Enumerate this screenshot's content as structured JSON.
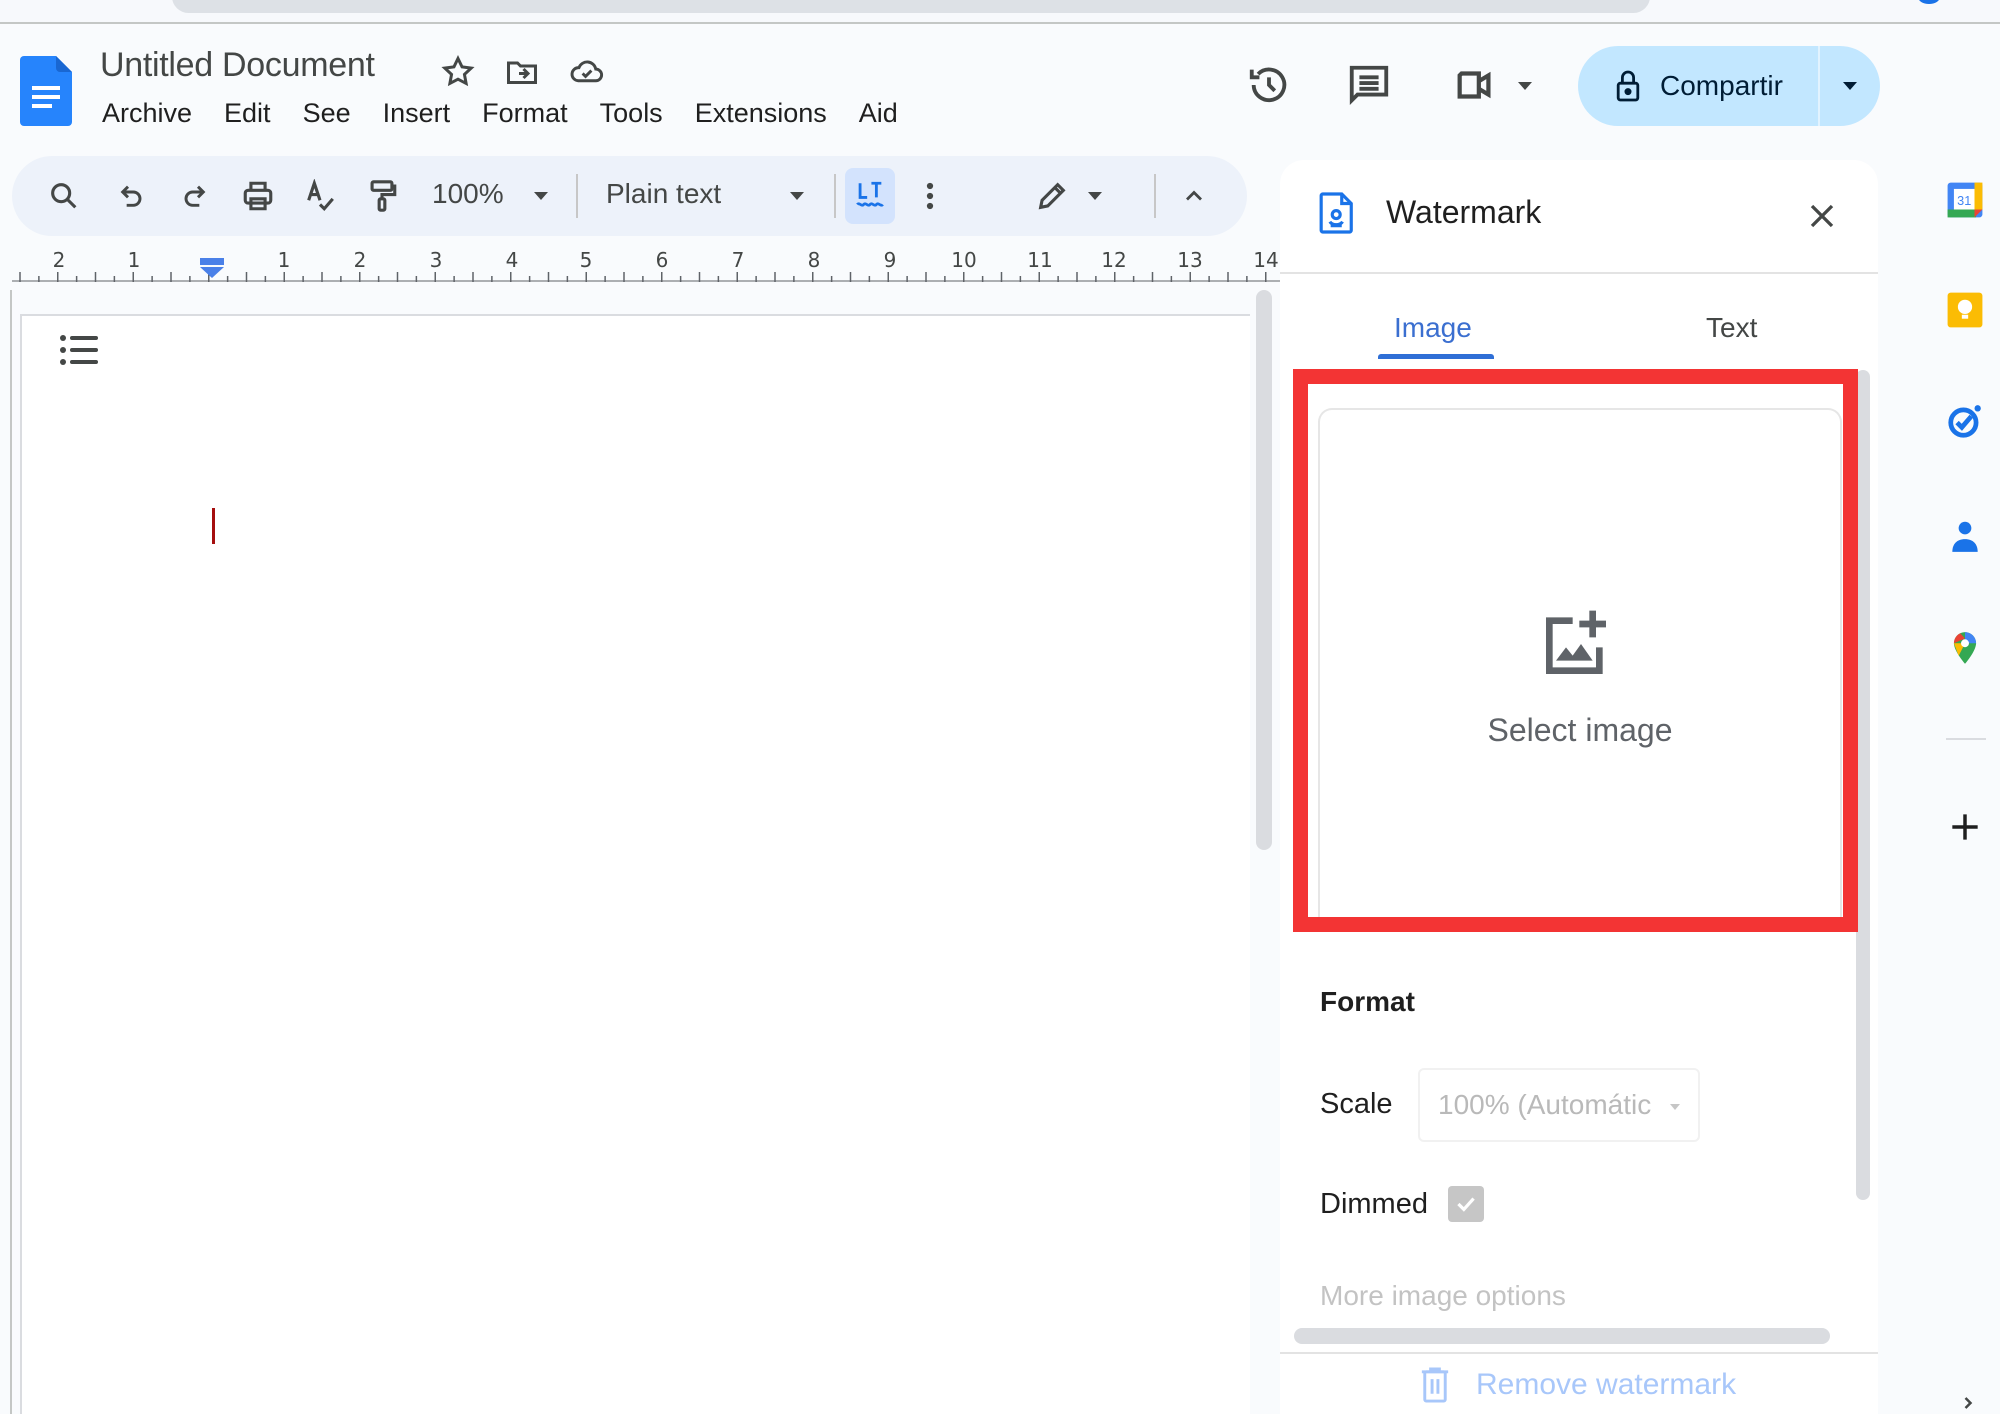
{
  "document": {
    "title": "Untitled Document"
  },
  "menu": [
    "Archive",
    "Edit",
    "See",
    "Insert",
    "Format",
    "Tools",
    "Extensions",
    "Aid"
  ],
  "share": {
    "label": "Compartir"
  },
  "toolbar": {
    "zoom": "100%",
    "style": "Plain text"
  },
  "ruler": {
    "labels": [
      "2",
      "1",
      "1",
      "2",
      "3",
      "4",
      "5",
      "6",
      "7",
      "8",
      "9",
      "10",
      "11",
      "12",
      "13",
      "14"
    ]
  },
  "watermark_panel": {
    "title": "Watermark",
    "tabs": [
      {
        "label": "Image",
        "active": true
      },
      {
        "label": "Text",
        "active": false
      }
    ],
    "select_image_label": "Select image",
    "format_heading": "Format",
    "scale_label": "Scale",
    "scale_value": "100% (Automátic",
    "dimmed_label": "Dimmed",
    "dimmed_checked": true,
    "more_options": "More image options",
    "remove_label": "Remove watermark"
  },
  "right_rail": {
    "apps": [
      "calendar",
      "keep",
      "tasks",
      "contacts",
      "maps"
    ]
  },
  "colors": {
    "accent": "#1a73e8",
    "share_bg": "#c2e7ff",
    "highlight_box": "#f33434",
    "tab_active": "#3b6fd0",
    "cursor": "#a50e0e"
  }
}
